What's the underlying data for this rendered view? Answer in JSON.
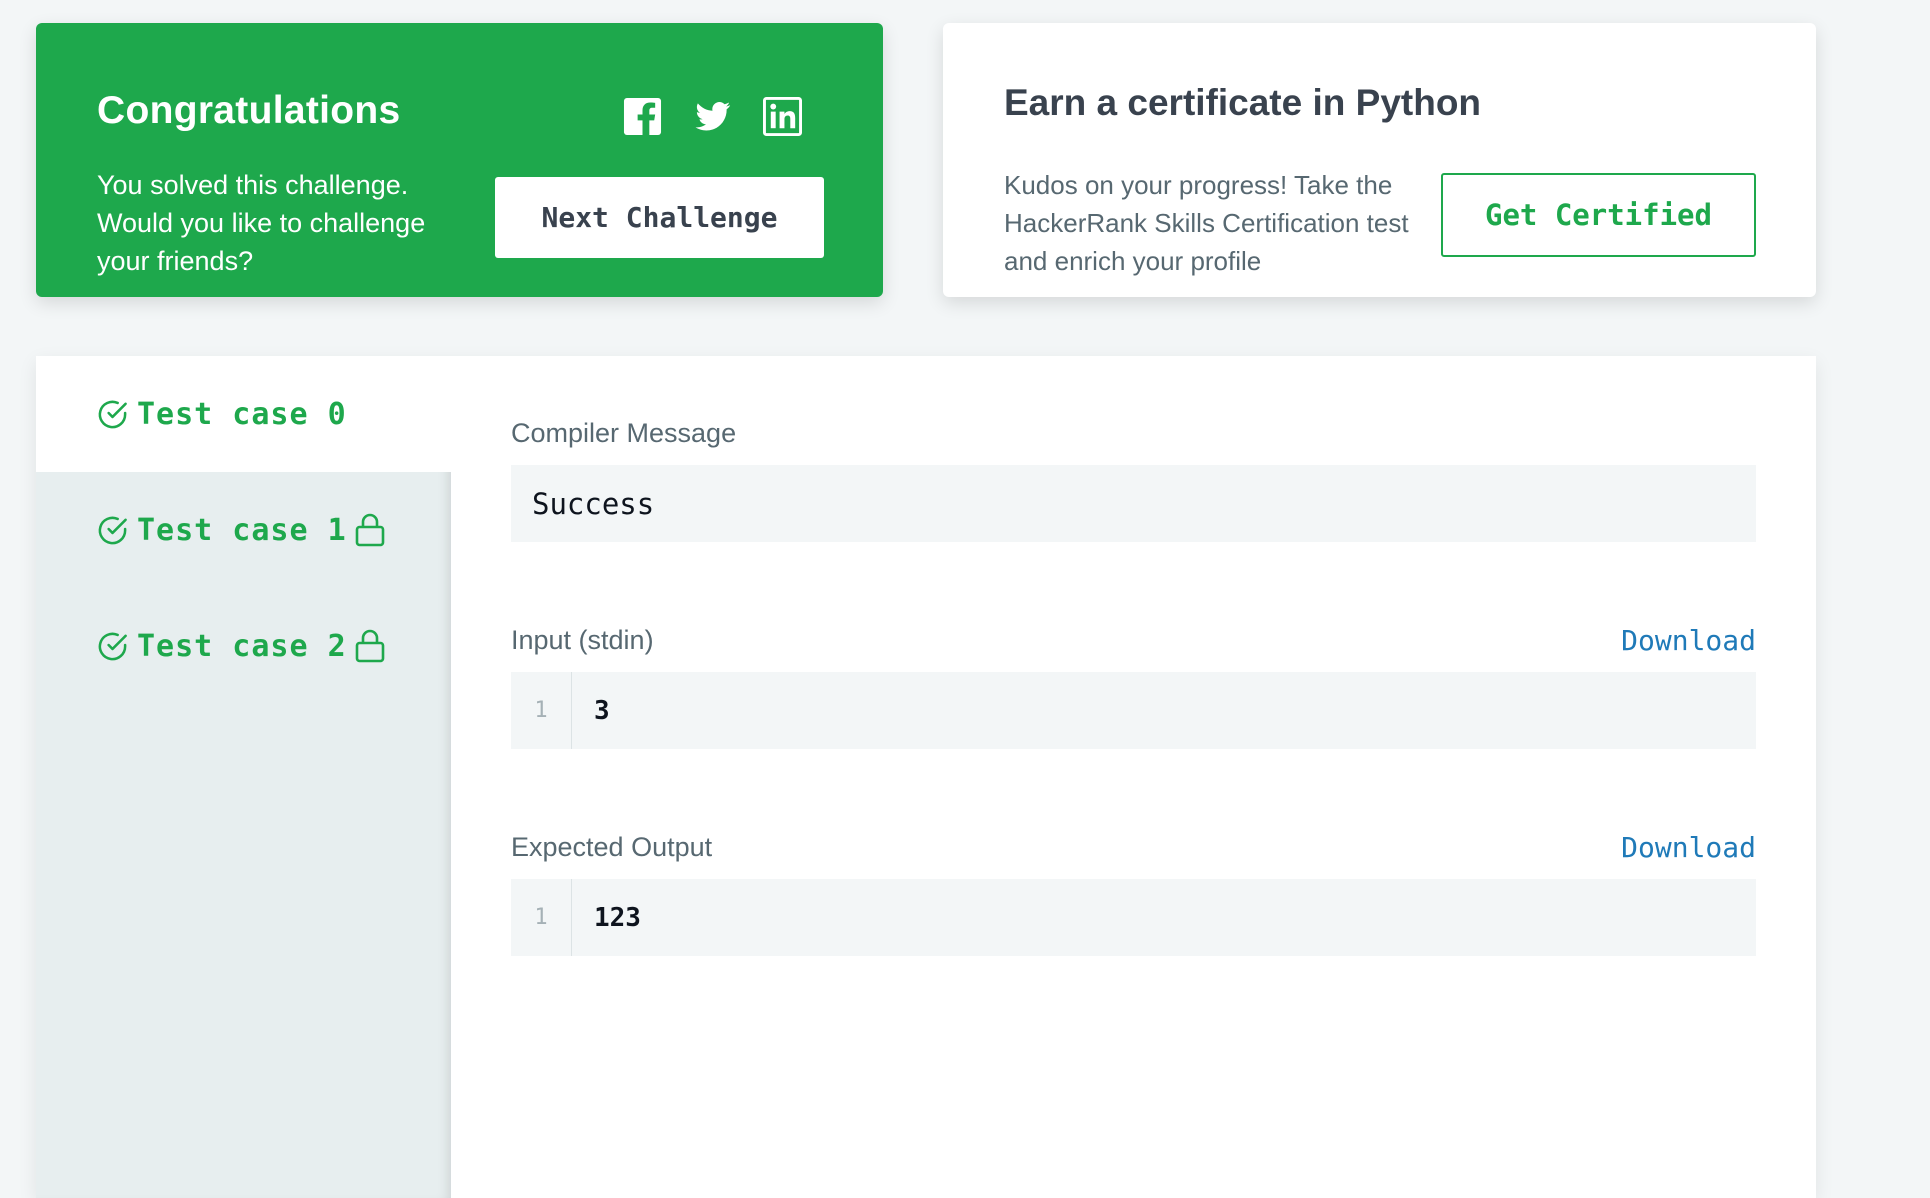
{
  "congrats": {
    "title": "Congratulations",
    "message_line1": "You solved this challenge.",
    "message_line2": "Would you like to challenge",
    "message_line3": "your friends?",
    "next_button": "Next Challenge",
    "social": [
      "facebook-icon",
      "twitter-icon",
      "linkedin-icon"
    ]
  },
  "certificate": {
    "title": "Earn a certificate in Python",
    "text_line1": "Kudos on your progress! Take the",
    "text_line2": "HackerRank Skills Certification test",
    "text_line3": "and enrich your profile",
    "button": "Get Certified"
  },
  "tabs": [
    {
      "label": "Test case 0",
      "status": "passed",
      "locked": false,
      "active": true
    },
    {
      "label": "Test case 1",
      "status": "passed",
      "locked": true,
      "active": false
    },
    {
      "label": "Test case 2",
      "status": "passed",
      "locked": true,
      "active": false
    }
  ],
  "result": {
    "compiler_label": "Compiler Message",
    "compiler_message": "Success",
    "input_label": "Input (stdin)",
    "input_download": "Download",
    "input_lines": [
      {
        "no": "1",
        "text": "3"
      }
    ],
    "expected_label": "Expected Output",
    "expected_download": "Download",
    "expected_lines": [
      {
        "no": "1",
        "text": "123"
      }
    ]
  },
  "colors": {
    "accent_green": "#1ea84c",
    "link_blue": "#1f7ab8",
    "page_bg": "#f3f6f7"
  }
}
